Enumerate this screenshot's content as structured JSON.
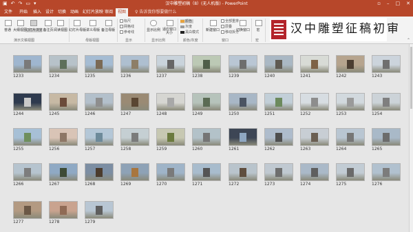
{
  "window": {
    "title": "汉中雕塑初稿（8）(无人机版) - PowerPoint",
    "qat": [
      "save-icon",
      "undo-icon",
      "redo-icon",
      "start-icon",
      "more-icon"
    ],
    "controls": [
      "minimize-icon",
      "maximize-icon",
      "close-icon"
    ]
  },
  "menu": {
    "tabs": [
      "文件",
      "开始",
      "插入",
      "设计",
      "切换",
      "动画",
      "幻灯片放映",
      "审阅",
      "视图"
    ],
    "active": "视图",
    "tellme": "告诉我你想要做什么"
  },
  "ribbon": {
    "buttons": [
      {
        "name": "normal-view-button",
        "label": "普通"
      },
      {
        "name": "outline-view-button",
        "label": "大纲视图"
      },
      {
        "name": "slide-sorter-button",
        "label": "幻灯片浏览"
      },
      {
        "name": "notes-page-button",
        "label": "备注页"
      },
      {
        "name": "reading-view-button",
        "label": "阅读视图"
      },
      {
        "name": "slide-master-button",
        "label": "幻灯片母版"
      },
      {
        "name": "handout-master-button",
        "label": "讲义母版"
      },
      {
        "name": "notes-master-button",
        "label": "备注母版"
      },
      {
        "name": "zoom-button",
        "label": "显示比例"
      },
      {
        "name": "fit-window-button",
        "label": "适应窗口大小"
      },
      {
        "name": "new-window-button",
        "label": "新建窗口"
      },
      {
        "name": "switch-windows-button",
        "label": "切换窗口"
      },
      {
        "name": "macros-button",
        "label": "宏"
      }
    ],
    "show_options": [
      "标尺",
      "网格线",
      "参考线"
    ],
    "color_options": [
      "颜色",
      "灰度",
      "黑白模式"
    ],
    "color_swatches": [
      "#e8a33d",
      "#9a9a9a",
      "#222222"
    ],
    "window_options": [
      "全部重排",
      "层叠",
      "移动拆分"
    ],
    "groups": [
      "演示文稿视图",
      "母版视图",
      "显示",
      "显示比例",
      "颜色/灰度",
      "窗口",
      "宏"
    ]
  },
  "logo_text": "汉中雕塑征稿初审",
  "slides": [
    {
      "n": "1233",
      "c": "#9fb6cf",
      "s": "#7a7a7a"
    },
    {
      "n": "1234",
      "c": "#b7c2c9",
      "s": "#5d6f5a"
    },
    {
      "n": "1235",
      "c": "#a5bcd3",
      "s": "#7b6a55"
    },
    {
      "n": "1236",
      "c": "#aebfd0",
      "s": "#8d7e67"
    },
    {
      "n": "1237",
      "c": "#c9d3db",
      "s": "#666666"
    },
    {
      "n": "1238",
      "c": "#bcc9b5",
      "s": "#4f5e49"
    },
    {
      "n": "1239",
      "c": "#b9c6d4",
      "s": "#6e6e6e"
    },
    {
      "n": "1240",
      "c": "#aab8c4",
      "s": "#5f5a52"
    },
    {
      "n": "1241",
      "c": "#d8dbd6",
      "s": "#7e6246"
    },
    {
      "n": "1242",
      "c": "#b6a48e",
      "s": "#4b3d31"
    },
    {
      "n": "1243",
      "c": "#ccd4dc",
      "s": "#6f6f6f"
    },
    {
      "n": "1244",
      "c": "#2e3a4e",
      "s": "#c9c9c9"
    },
    {
      "n": "1245",
      "c": "#c7b9a4",
      "s": "#6b4b3a"
    },
    {
      "n": "1246",
      "c": "#b3c0cb",
      "s": "#8e8e8e"
    },
    {
      "n": "1247",
      "c": "#9a8a74",
      "s": "#5a4632"
    },
    {
      "n": "1248",
      "c": "#d6d6d2",
      "s": "#a8a8a8"
    },
    {
      "n": "1249",
      "c": "#b6c3bb",
      "s": "#5b6b54"
    },
    {
      "n": "1250",
      "c": "#a8b7c6",
      "s": "#4b5462"
    },
    {
      "n": "1251",
      "c": "#c2cfd8",
      "s": "#6c8a5d"
    },
    {
      "n": "1252",
      "c": "#d7dde2",
      "s": "#8d8d8d"
    },
    {
      "n": "1253",
      "c": "#d2d9de",
      "s": "#9a9a9a"
    },
    {
      "n": "1254",
      "c": "#ccd3d8",
      "s": "#7f7f7f"
    },
    {
      "n": "1255",
      "c": "#a7c0d6",
      "s": "#6f8f5e"
    },
    {
      "n": "1256",
      "c": "#d9c4b6",
      "s": "#8e7766"
    },
    {
      "n": "1257",
      "c": "#b4c7d7",
      "s": "#6d8a9a"
    },
    {
      "n": "1258",
      "c": "#c5cfd3",
      "s": "#7b7b7b"
    },
    {
      "n": "1259",
      "c": "#c7c8b2",
      "s": "#6b7a3e"
    },
    {
      "n": "1260",
      "c": "#b3c2c9",
      "s": "#757575"
    },
    {
      "n": "1261",
      "c": "#3d4655",
      "s": "#8fa7c2"
    },
    {
      "n": "1262",
      "c": "#aebccc",
      "s": "#4e4e4e"
    },
    {
      "n": "1263",
      "c": "#c8ced4",
      "s": "#6b5f52"
    },
    {
      "n": "1264",
      "c": "#b9c6d2",
      "s": "#767676"
    },
    {
      "n": "1265",
      "c": "#a9b9c8",
      "s": "#6c6c6c"
    },
    {
      "n": "1266",
      "c": "#b6c4cf",
      "s": "#7d7d7d"
    },
    {
      "n": "1267",
      "c": "#8fa9c4",
      "s": "#3d4b36"
    },
    {
      "n": "1268",
      "c": "#7c8ea3",
      "s": "#4b3b2d"
    },
    {
      "n": "1269",
      "c": "#8ea2b6",
      "s": "#a8763f"
    },
    {
      "n": "1270",
      "c": "#9fb4c8",
      "s": "#7a7a7a"
    },
    {
      "n": "1271",
      "c": "#a8bccd",
      "s": "#555555"
    },
    {
      "n": "1272",
      "c": "#b9c4cc",
      "s": "#5f4e3e"
    },
    {
      "n": "1273",
      "c": "#c0c9d1",
      "s": "#6e6e6e"
    },
    {
      "n": "1274",
      "c": "#aab9c8",
      "s": "#5f5f5f"
    },
    {
      "n": "1275",
      "c": "#c2ccd4",
      "s": "#6a6a6a"
    },
    {
      "n": "1276",
      "c": "#b1c1cf",
      "s": "#7c7c7c"
    },
    {
      "n": "1277",
      "c": "#b39a82",
      "s": "#6b5846"
    },
    {
      "n": "1278",
      "c": "#c9a38f",
      "s": "#8f6a55"
    },
    {
      "n": "1279",
      "c": "#b8c6d3",
      "s": "#5e5e5e"
    }
  ]
}
